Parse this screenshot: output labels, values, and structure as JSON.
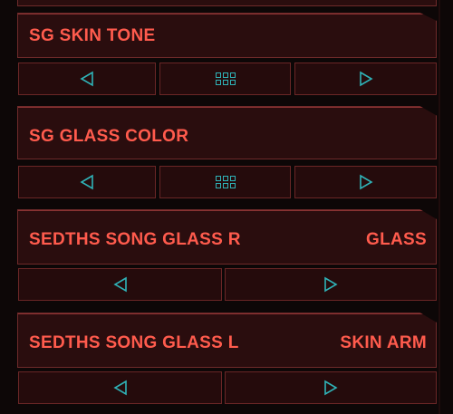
{
  "items": [
    {
      "label": "SG SKIN TONE",
      "value": ""
    },
    {
      "label": "SG GLASS COLOR",
      "value": ""
    },
    {
      "label": "SEDTHS SONG GLASS R",
      "value": "GLASS"
    },
    {
      "label": "SEDTHS SONG GLASS L",
      "value": "SKIN ARM"
    }
  ],
  "icons": {
    "prev": "triangle-left-icon",
    "next": "triangle-right-icon",
    "grid": "grid-icon"
  },
  "colors": {
    "accent_text": "#ff5b4d",
    "icon": "#2fb3b8",
    "panel_bg": "#2a0d0e",
    "border": "#6e2a2a",
    "background": "#0d0707"
  }
}
